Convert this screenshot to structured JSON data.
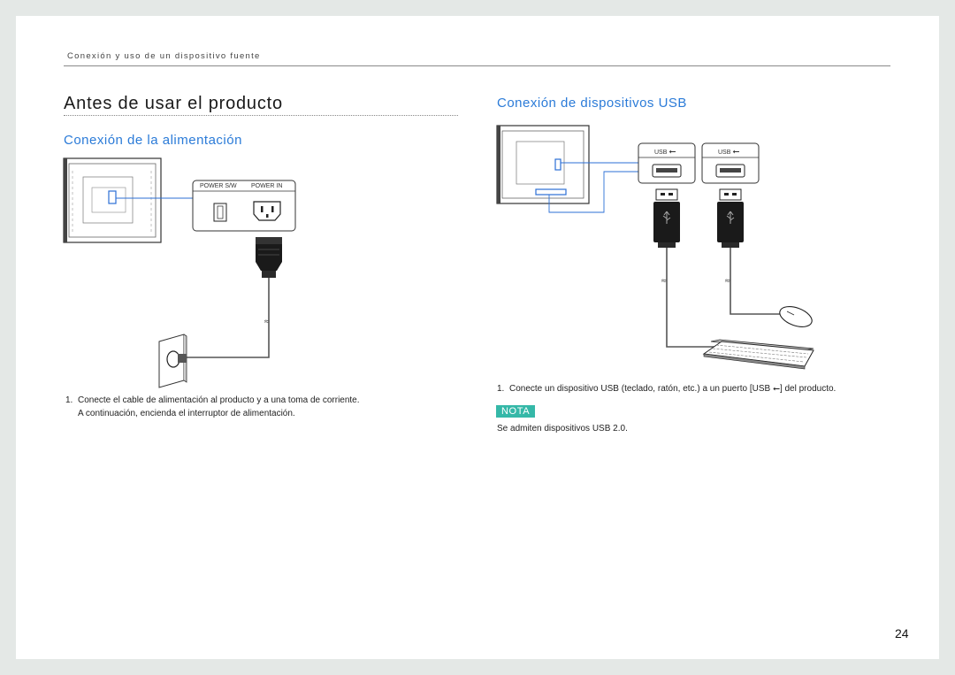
{
  "header": {
    "section": "Conexión y uso de un dispositivo fuente"
  },
  "title": "Antes de usar el producto",
  "power": {
    "heading": "Conexión de la alimentación",
    "labels": {
      "switch": "POWER S/W",
      "inlet": "POWER IN"
    },
    "step_number": "1.",
    "step_line1": "Conecte el cable de alimentación al producto y a una toma de corriente.",
    "step_line2": "A continuación, encienda el interruptor de alimentación."
  },
  "usb": {
    "heading": "Conexión de dispositivos USB",
    "port_label_1": "USB",
    "port_label_2": "USB",
    "step_number": "1.",
    "step_text_before": "Conecte un dispositivo USB (teclado, ratón, etc.) a un puerto [USB ",
    "step_text_after": "] del producto.",
    "note_label": "NOTA",
    "note_text": "Se admiten dispositivos USB 2.0."
  },
  "page_number": "24",
  "colors": {
    "accent_blue": "#2b7bd8",
    "note_teal": "#35b8a8",
    "connector_blue": "#2b6fd6"
  }
}
